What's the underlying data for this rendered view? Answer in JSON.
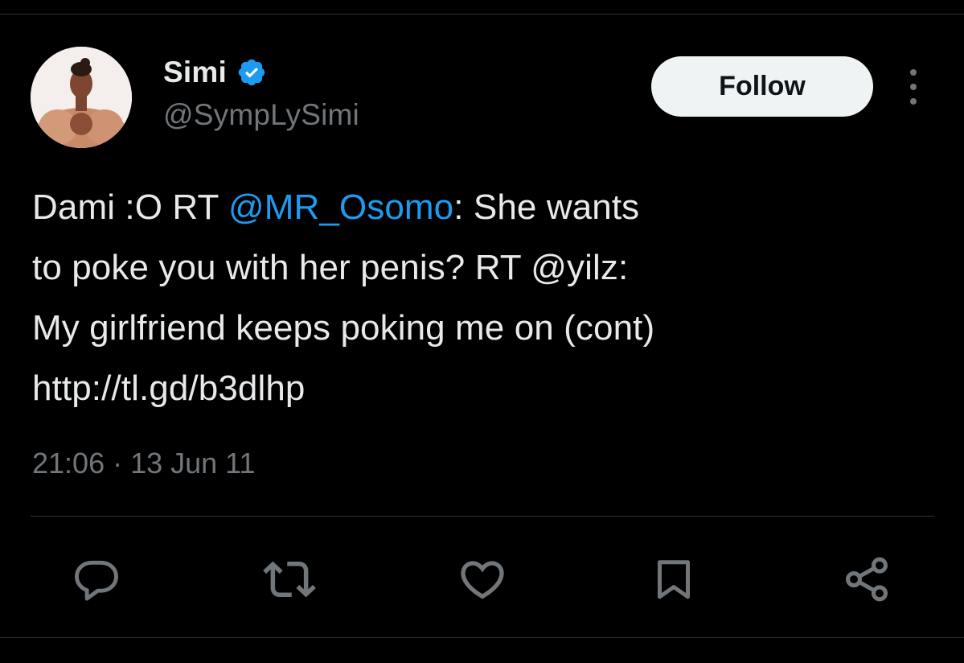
{
  "tweet": {
    "author": {
      "display_name": "Simi",
      "handle": "@SympLySimi",
      "verified": true
    },
    "follow_label": "Follow",
    "text": {
      "line1_a": "Dami :O RT ",
      "line1_mention": "@MR_Osomo",
      "line1_b": ": She wants",
      "line2": "to poke you with her penis? RT @yilz:",
      "line3": "My girlfriend keeps poking me on (cont)",
      "line4_url": "http://tl.gd/b3dlhp"
    },
    "time": "21:06",
    "separator": "·",
    "date": "13 Jun 11"
  },
  "actions": [
    {
      "name": "reply",
      "icon": "reply-icon"
    },
    {
      "name": "retweet",
      "icon": "retweet-icon"
    },
    {
      "name": "like",
      "icon": "heart-icon"
    },
    {
      "name": "bookmark",
      "icon": "bookmark-icon"
    },
    {
      "name": "share",
      "icon": "share-icon"
    }
  ],
  "colors": {
    "background": "#000000",
    "text_primary": "#e7e9ea",
    "text_secondary": "#71767b",
    "accent": "#1d9bf0",
    "divider": "#2f3336",
    "follow_bg": "#eff3f4"
  }
}
